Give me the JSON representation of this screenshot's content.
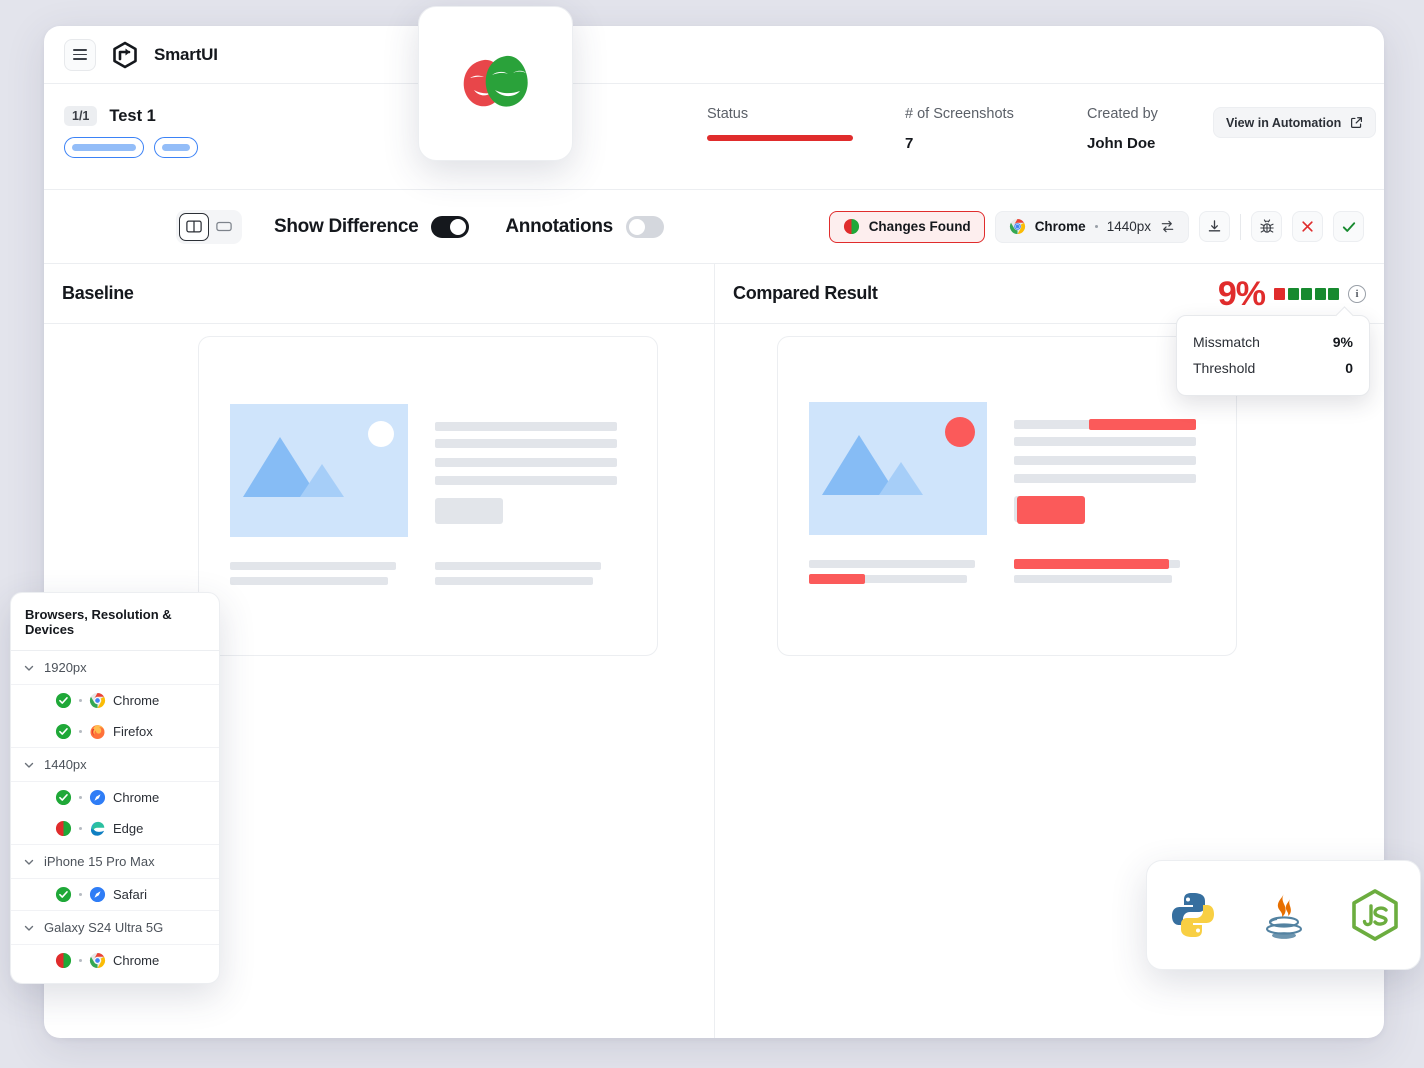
{
  "app": {
    "brand": "SmartUI",
    "menu_icon": "hamburger-icon",
    "logo_icon": "smartui-logo-icon"
  },
  "meta": {
    "count_badge": "1/1",
    "test_name": "Test 1",
    "status_label": "Status",
    "status_color": "#e02c2c",
    "screenshots_label": "# of Screenshots",
    "screenshots_value": "7",
    "created_by_label": "Created by",
    "created_by_value": "John Doe",
    "automation_button": "View in Automation",
    "share_icon": "share-icon",
    "external_link_icon": "external-link-icon"
  },
  "toolbar": {
    "view_split_icon": "split-view-icon",
    "view_single_icon": "single-view-icon",
    "show_difference_label": "Show Difference",
    "show_difference_on": true,
    "annotations_label": "Annotations",
    "annotations_on": false,
    "changes_badge": "Changes Found",
    "changes_icon": "half-circle-red-green-icon",
    "browser_name": "Chrome",
    "browser_icon": "chrome-icon",
    "resolution": "1440px",
    "swap_icon": "swap-arrows-icon",
    "download_icon": "download-icon",
    "bug_icon": "bug-icon",
    "reject_icon": "close-x-icon",
    "approve_icon": "check-icon"
  },
  "compare": {
    "baseline_title": "Baseline",
    "compared_title": "Compared Result",
    "mismatch_percent": "9%",
    "info_icon": "info-icon",
    "segments": [
      "#e02c2c",
      "#178a2f",
      "#178a2f",
      "#178a2f",
      "#178a2f"
    ],
    "tooltip": {
      "mismatch_key": "Missmatch",
      "mismatch_value": "9%",
      "threshold_key": "Threshold",
      "threshold_value": "0"
    }
  },
  "browsers_panel": {
    "title": "Browsers, Resolution & Devices",
    "groups": [
      {
        "label": "1920px",
        "items": [
          {
            "status": "pass",
            "browser": "Chrome",
            "icon": "chrome-icon"
          },
          {
            "status": "pass",
            "browser": "Firefox",
            "icon": "firefox-icon"
          }
        ]
      },
      {
        "label": "1440px",
        "items": [
          {
            "status": "pass",
            "browser": "Chrome",
            "icon": "chrome-blue-icon"
          },
          {
            "status": "changes",
            "browser": "Edge",
            "icon": "edge-icon"
          }
        ]
      },
      {
        "label": "iPhone 15 Pro Max",
        "items": [
          {
            "status": "pass",
            "browser": "Safari",
            "icon": "safari-icon"
          }
        ]
      },
      {
        "label": "Galaxy S24 Ultra 5G",
        "items": [
          {
            "status": "changes",
            "browser": "Chrome",
            "icon": "chrome-icon"
          }
        ]
      }
    ]
  },
  "floating": {
    "playwright_icon": "playwright-masks-icon",
    "languages": [
      "python-icon",
      "java-icon",
      "nodejs-icon"
    ]
  }
}
